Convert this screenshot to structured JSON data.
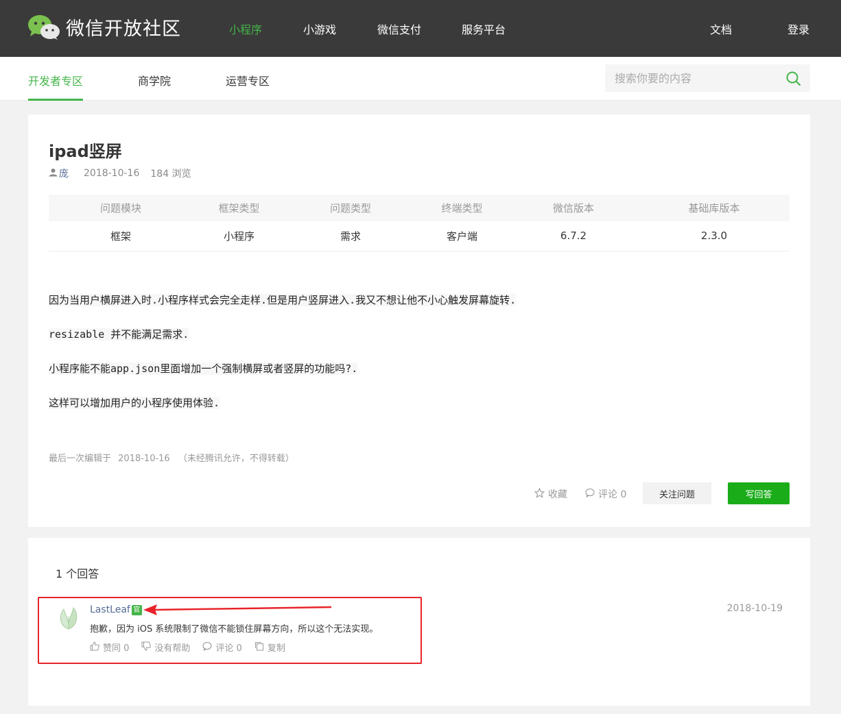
{
  "header": {
    "site_name": "微信开放社区",
    "nav": [
      "小程序",
      "小游戏",
      "微信支付",
      "服务平台"
    ],
    "docs": "文档",
    "login": "登录"
  },
  "subnav": {
    "tabs": [
      "开发者专区",
      "商学院",
      "运营专区"
    ],
    "search_placeholder": "搜索你要的内容"
  },
  "question": {
    "title": "ipad竖屏",
    "author": "庞",
    "date": "2018-10-16",
    "views": "184 浏览",
    "table_headers": [
      "问题模块",
      "框架类型",
      "问题类型",
      "终端类型",
      "微信版本",
      "基础库版本"
    ],
    "table_values": [
      "框架",
      "小程序",
      "需求",
      "客户端",
      "6.7.2",
      "2.3.0"
    ],
    "body": [
      "因为当用户横屏进入时.小程序样式会完全走样.但是用户竖屏进入.我又不想让他不小心触发屏幕旋转.",
      "resizable 并不能满足需求.",
      "小程序能不能app.json里面增加一个强制横屏或者竖屏的功能吗?.",
      "这样可以增加用户的小程序使用体验."
    ],
    "edited_label": "最后一次编辑于",
    "edited_date": "2018-10-16",
    "edited_note": "（未经腾讯允许，不得转载）",
    "actions": {
      "favorite": "收藏",
      "comment": "评论 0",
      "follow": "关注问题",
      "answer": "写回答"
    }
  },
  "answers": {
    "count": "1 个回答",
    "items": [
      {
        "user": "LastLeaf",
        "badge": "官",
        "date": "2018-10-19",
        "text": "抱歉，因为 iOS 系统限制了微信不能锁住屏幕方向，所以这个无法实现。",
        "like": "赞同 0",
        "unhelpful": "没有帮助",
        "comment": "评论 0",
        "copy": "复制"
      }
    ]
  },
  "colors": {
    "accent": "#44b549",
    "primary_button": "#1aad19",
    "topbar": "#3a3a3a",
    "annotation": "#e8232a"
  }
}
